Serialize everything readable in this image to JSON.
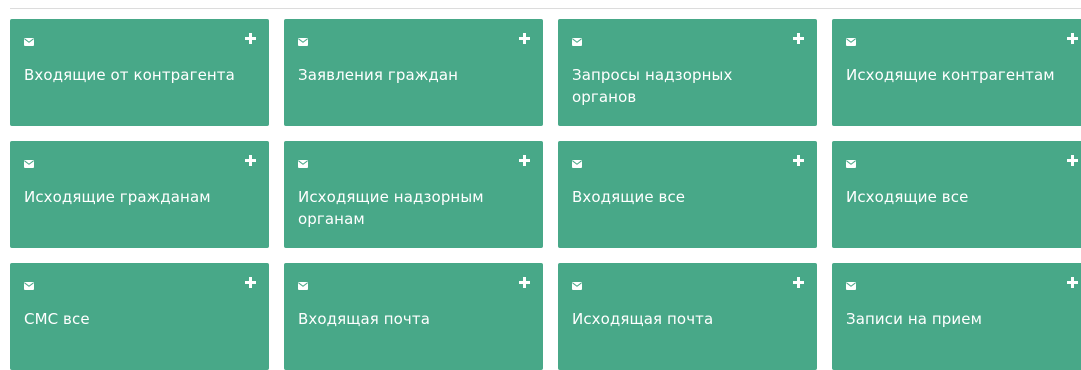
{
  "tiles": [
    {
      "label": "Входящие от контрагента",
      "icon": "envelope-icon",
      "action_icon": "plus-icon"
    },
    {
      "label": "Заявления граждан",
      "icon": "envelope-icon",
      "action_icon": "plus-icon"
    },
    {
      "label": "Запросы надзорных органов",
      "icon": "envelope-icon",
      "action_icon": "plus-icon"
    },
    {
      "label": "Исходящие контрагентам",
      "icon": "envelope-icon",
      "action_icon": "plus-icon"
    },
    {
      "label": "Исходящие гражданам",
      "icon": "envelope-icon",
      "action_icon": "plus-icon"
    },
    {
      "label": "Исходящие надзорным органам",
      "icon": "envelope-icon",
      "action_icon": "plus-icon"
    },
    {
      "label": "Входящие все",
      "icon": "envelope-icon",
      "action_icon": "plus-icon"
    },
    {
      "label": "Исходящие все",
      "icon": "envelope-icon",
      "action_icon": "plus-icon"
    },
    {
      "label": "СМС все",
      "icon": "envelope-icon",
      "action_icon": "plus-icon"
    },
    {
      "label": "Входящая почта",
      "icon": "envelope-icon",
      "action_icon": "plus-icon"
    },
    {
      "label": "Исходящая почта",
      "icon": "envelope-icon",
      "action_icon": "plus-icon"
    },
    {
      "label": "Записи на прием",
      "icon": "envelope-icon",
      "action_icon": "plus-icon"
    }
  ],
  "colors": {
    "tile_background": "#48a888",
    "tile_text": "#ffffff",
    "divider": "#dcdcdc"
  }
}
